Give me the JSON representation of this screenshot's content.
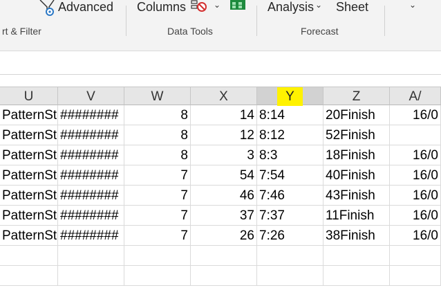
{
  "ribbon": {
    "advanced_label": "Advanced",
    "columns_label": "Columns",
    "analysis_label": "Analysis",
    "sheet_label": "Sheet",
    "groups": {
      "sort_filter": "rt & Filter",
      "data_tools": "Data Tools",
      "forecast": "Forecast"
    }
  },
  "grid": {
    "columns": [
      "U",
      "V",
      "W",
      "X",
      "Y",
      "Z",
      "A/"
    ],
    "selected_column": "Y",
    "highlight_color": "#fff200",
    "rows": [
      [
        "PatternSta",
        "########",
        "8",
        "14",
        "8:14",
        "20Finish",
        "16/0"
      ],
      [
        "PatternSta",
        "########",
        "8",
        "12",
        "8:12",
        "52Finish",
        ""
      ],
      [
        "PatternSta",
        "########",
        "8",
        "3",
        "8:3",
        "18Finish",
        "16/0"
      ],
      [
        "PatternSta",
        "########",
        "7",
        "54",
        "7:54",
        "40Finish",
        "16/0"
      ],
      [
        "PatternSta",
        "########",
        "7",
        "46",
        "7:46",
        "43Finish",
        "16/0"
      ],
      [
        "PatternSta",
        "########",
        "7",
        "37",
        "7:37",
        "11Finish",
        "16/0"
      ],
      [
        "PatternSta",
        "########",
        "7",
        "26",
        "7:26",
        "38Finish",
        "16/0"
      ]
    ]
  }
}
